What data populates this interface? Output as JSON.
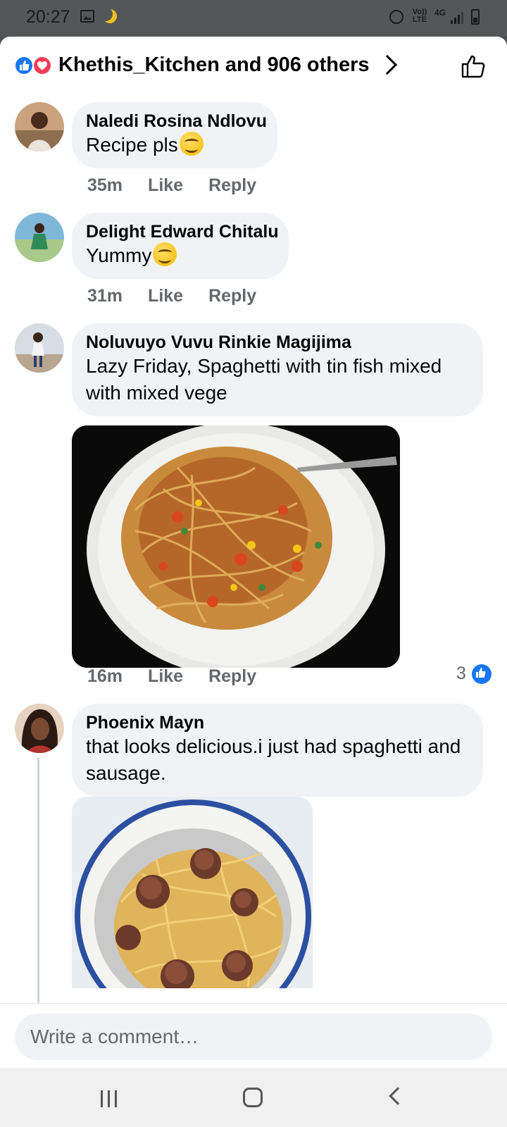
{
  "status_bar": {
    "time": "20:27",
    "volte": "Vo)) LTE",
    "network": "4G",
    "icons": [
      "gallery-icon",
      "moon-icon",
      "alarm-icon",
      "signal-icon",
      "battery-icon"
    ]
  },
  "reactions_header": {
    "text": "Khethis_Kitchen and 906 others",
    "reaction_icons": [
      "like-reaction-icon",
      "love-reaction-icon"
    ]
  },
  "comments": [
    {
      "author": "Naledi Rosina Ndlovu",
      "text": "Recipe pls",
      "emoji": "smiling-face-savoring-food",
      "time": "35m",
      "like": "Like",
      "reply": "Reply"
    },
    {
      "author": "Delight Edward Chitalu",
      "text": "Yummy",
      "emoji": "smiling-face-savoring-food",
      "time": "31m",
      "like": "Like",
      "reply": "Reply"
    },
    {
      "author": "Noluvuyo Vuvu Rinkie Magijima",
      "text": "Lazy Friday, Spaghetti with tin fish mixed with mixed vege",
      "photo": "spaghetti-with-tin-fish-and-vegetables",
      "time": "16m",
      "like": "Like",
      "reply": "Reply",
      "reaction_count": "3"
    },
    {
      "author": "Phoenix Mayn",
      "text": "that looks delicious.i just had spaghetti and sausage.",
      "photo": "spaghetti-and-sausage"
    }
  ],
  "composer": {
    "placeholder": "Write a comment…"
  },
  "colors": {
    "accent": "#1877f2",
    "love": "#f33e58",
    "bubble": "#f0f2f5",
    "meta": "#65676b"
  }
}
